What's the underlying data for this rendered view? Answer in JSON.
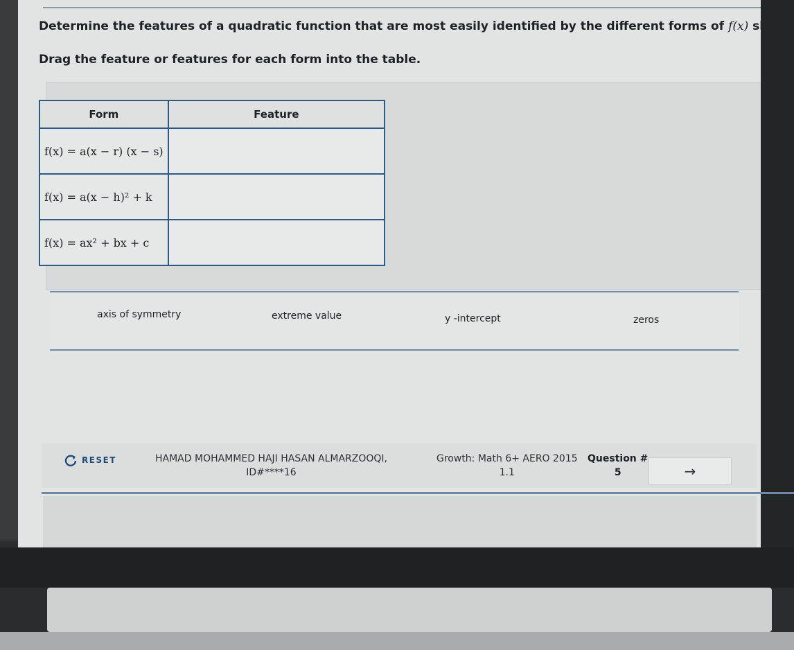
{
  "instructions": {
    "line1_prefix": "Determine the features of a quadratic function that are most easily identified by the different forms of ",
    "line1_fx": "f(x)",
    "line1_suffix": " shown in the table.",
    "line2": "Drag the feature or features for each form into the table."
  },
  "table": {
    "headers": {
      "form": "Form",
      "feature": "Feature"
    },
    "rows": [
      {
        "form": "f(x) = a(x − r) (x − s)",
        "feature": ""
      },
      {
        "form": "f(x) = a(x − h)² + k",
        "feature": ""
      },
      {
        "form": "f(x) = ax² + bx + c",
        "feature": ""
      }
    ]
  },
  "choices": [
    "axis of symmetry",
    "extreme value",
    "y -intercept",
    "zeros"
  ],
  "footer": {
    "reset_label": "RESET",
    "student_name": "HAMAD MOHAMMED HAJI HASAN ALMARZOOQI,",
    "student_id": "ID#****16",
    "course": "Growth: Math 6+ AERO 2015",
    "course_section": "1.1",
    "question_label": "Question #",
    "question_number": "5",
    "next_icon": "→"
  },
  "colors": {
    "table_border": "#2e5a86",
    "reset_blue": "#1e4c7a",
    "rule_blue": "#6c8aa8"
  }
}
